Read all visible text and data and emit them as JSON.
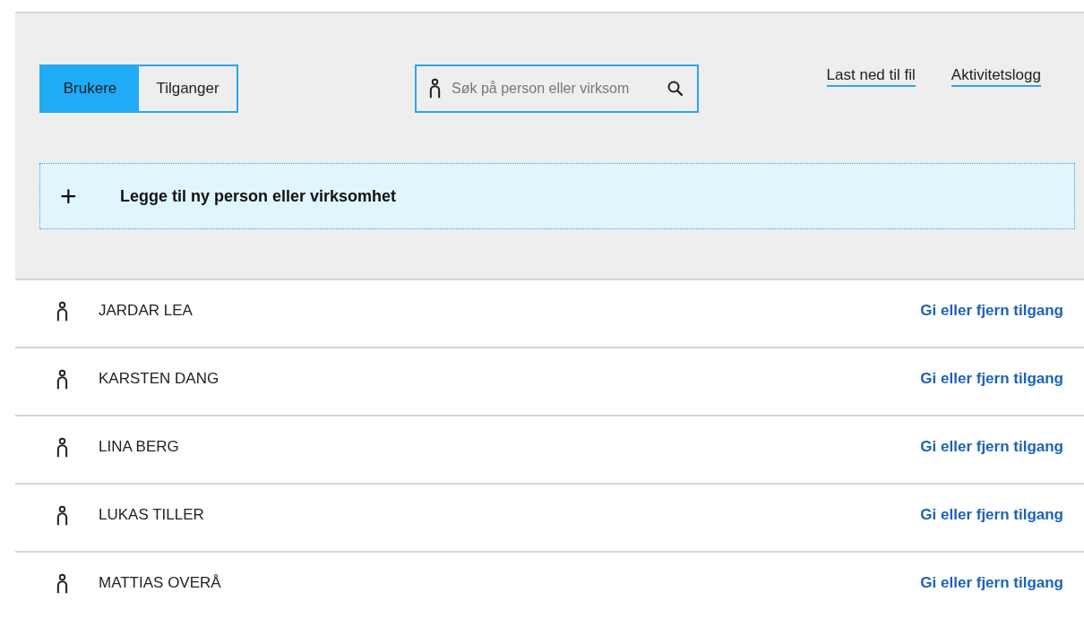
{
  "tabs": [
    {
      "label": "Brukere",
      "selected": true
    },
    {
      "label": "Tilganger",
      "selected": false
    }
  ],
  "search": {
    "placeholder": "Søk på person eller virksom"
  },
  "links": [
    "Last ned til fil",
    "Aktivitetslogg"
  ],
  "add_button": {
    "icon": "+",
    "label": "Legge til ny person eller virksomhet"
  },
  "users": [
    {
      "name": "JARDAR LEA",
      "action": "Gi eller fjern tilgang"
    },
    {
      "name": "KARSTEN DANG",
      "action": "Gi eller fjern tilgang"
    },
    {
      "name": "LINA BERG",
      "action": "Gi eller fjern tilgang"
    },
    {
      "name": "LUKAS TILLER",
      "action": "Gi eller fjern tilgang"
    },
    {
      "name": "MATTIAS OVERÅ",
      "action": "Gi eller fjern tilgang"
    }
  ]
}
